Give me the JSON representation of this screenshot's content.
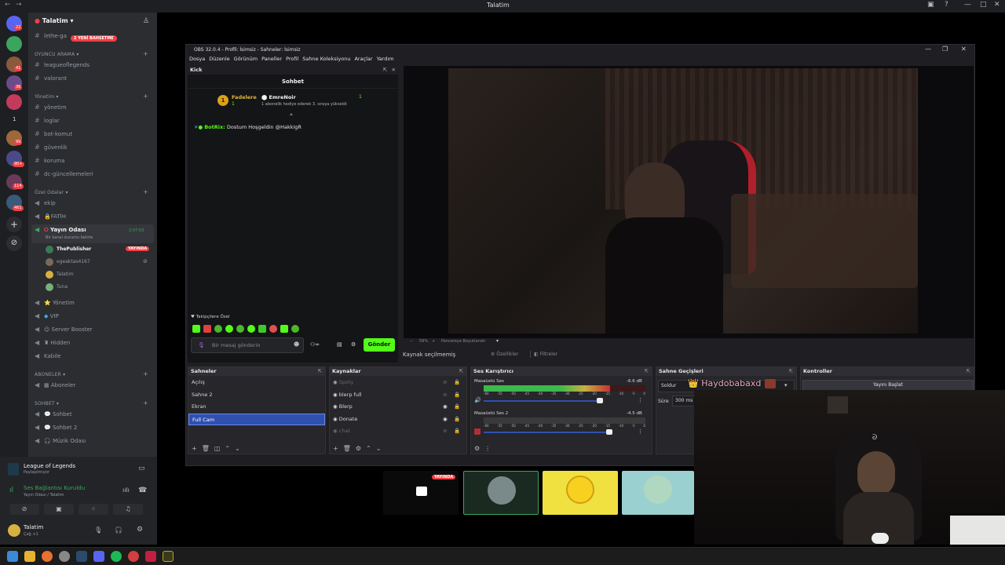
{
  "window": {
    "title": "Talatim"
  },
  "server": {
    "name": "Talatim",
    "top_channel": "lethe-ga",
    "announce_badge": "2 YENİ BAHSETME",
    "rail_badges": [
      "22",
      "41",
      "36",
      "1",
      "99",
      "90+",
      "114",
      "461"
    ]
  },
  "categories": {
    "oyuncu": "OYUNCU ARAMA",
    "yonetim": "Yönetim",
    "ozel": "Özel Odalar",
    "aboneler": "ABONELER",
    "sohbet": "SOHBET"
  },
  "channels": {
    "oyuncu": [
      "leagueoflegends",
      "valorant"
    ],
    "yonetim": [
      "yönetim",
      "loglar",
      "bot-komut",
      "güvenlik",
      "koruma",
      "dc-güncellemeleri"
    ],
    "ozel_text": [
      "ekip",
      "FATİH"
    ],
    "voice_room": "Yayın Odası",
    "voice_room_status": "Bir kanal durumu belirle",
    "voice_timer": "2:07:03",
    "voice_users": [
      "ThePublisher",
      "egeaktas4167",
      "Talatim",
      "Tuna"
    ],
    "live_badge": "YAYINDA",
    "voice_extra": [
      "Yönetim",
      "VIP",
      "Server Booster",
      "Hidden",
      "Kabile"
    ],
    "aboneler": [
      "Aboneler"
    ],
    "sohbet": [
      "Sohbet",
      "Sohbet 2",
      "Müzik Odası"
    ]
  },
  "user_panel": {
    "activity_title": "League of Legends",
    "activity_sub": "Paylaşılmıyor",
    "voice_status": "Ses Bağlantısı Kuruldu",
    "voice_channel": "Yayın Odası / Talatim",
    "username": "Talatim",
    "user_status": "Çağ +1"
  },
  "obs": {
    "title": "OBS 32.0.4 - Profil: İsimsiz - Sahneler: İsimsiz",
    "menu": [
      "Dosya",
      "Düzenle",
      "Görünüm",
      "Paneller",
      "Profil",
      "Sahne Koleksiyonu",
      "Araçlar",
      "Yardım"
    ],
    "zoom": "59%",
    "fit_label": "Pencereye Boyutlandır",
    "source_none": "Kaynak seçilmemiş",
    "props_btn": "Özellikler",
    "filters_btn": "Filtreler"
  },
  "kick": {
    "dock_title": "Kick",
    "chat_title": "Sohbet",
    "top_name": "Fadelere",
    "top_count": "1",
    "gift_name": "EmreNoir",
    "gift_count": "1",
    "gift_text": "1 abonelik hediye ederek 3. sıraya yükseldi",
    "msg_user": "BotRix:",
    "msg_text": "Dostum Hoşgeldin @HakkigR",
    "followers_label": "Takipçilere Özel",
    "input_placeholder": "Bir mesaj gönderin",
    "send_btn": "Gönder"
  },
  "scenes": {
    "title": "Sahneler",
    "items": [
      "Açılış",
      "Sahne 2",
      "Ekran",
      "Full Cam"
    ],
    "selected": "Full Cam"
  },
  "sources": {
    "title": "Kaynaklar",
    "items": [
      "Spoty",
      "blerp full",
      "Blerp",
      "Donate",
      "chat"
    ]
  },
  "mixer": {
    "title": "Ses Karıştırıcı",
    "ch1_name": "Masaüstü Ses",
    "ch1_db": "-6.6 dB",
    "ch2_name": "Masaüstü Ses 2",
    "ch2_db": "-4.5 dB",
    "scale": [
      "-60",
      "-55",
      "-50",
      "-45",
      "-40",
      "-35",
      "-30",
      "-25",
      "-20",
      "-15",
      "-10",
      "-5",
      "0"
    ],
    "ch1_level": 0.78,
    "ch2_level": 0.0
  },
  "transitions": {
    "title": "Sahne Geçişleri",
    "type": "Soldur",
    "duration_label": "Süre",
    "duration_value": "300 ms",
    "overlay_name": "Haydobabaxd :"
  },
  "controls": {
    "title": "Kontroller",
    "start_stream": "Yayını Başlat"
  },
  "thumbs": {
    "live_badge": "YAYINDA"
  }
}
